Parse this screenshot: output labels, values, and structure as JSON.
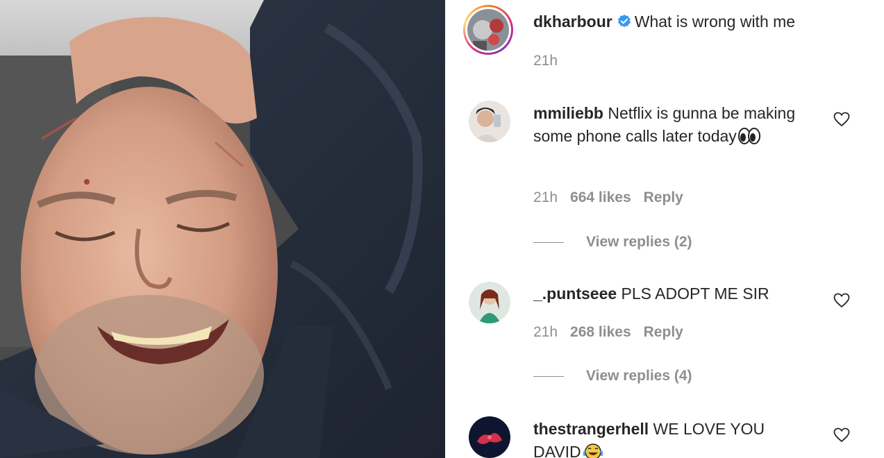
{
  "post": {
    "username": "dkharbour",
    "caption": "What is wrong with me",
    "time": "21h"
  },
  "comments": [
    {
      "username": "mmiliebb",
      "text": "Netflix is gunna be making some phone calls later today",
      "time": "21h",
      "likes": "664 likes",
      "reply_label": "Reply",
      "view_replies": "View replies (2)"
    },
    {
      "username": "_.puntseee",
      "text": "PLS ADOPT ME SIR",
      "time": "21h",
      "likes": "268 likes",
      "reply_label": "Reply",
      "view_replies": "View replies (4)"
    },
    {
      "username": "thestrangerhell",
      "text_line1": "WE LOVE YOU",
      "text_line2": "DAVID"
    }
  ],
  "icons": {
    "verified": "verified-badge-icon",
    "like": "heart-icon",
    "eyes_emoji": "eyes-emoji",
    "laugh_emoji": "tears-of-joy-emoji"
  },
  "colors": {
    "verified": "#3897f0",
    "muted_text": "#8e8e8e",
    "text": "#262626"
  }
}
